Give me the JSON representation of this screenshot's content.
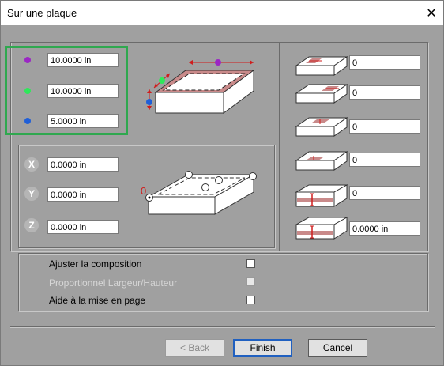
{
  "window": {
    "title": "Sur une plaque",
    "close_symbol": "✕"
  },
  "dimensions": {
    "width_value": "10.0000 in",
    "depth_value": "10.0000 in",
    "height_value": "5.0000 in",
    "colors": {
      "width": "#9b27c4",
      "depth": "#2ee85a",
      "height": "#1f5fd8"
    }
  },
  "position": {
    "x_label": "X",
    "x_value": "0.0000 in",
    "y_label": "Y",
    "y_value": "0.0000 in",
    "z_label": "Z",
    "z_value": "0.0000 in",
    "origin_label": "0"
  },
  "margins": {
    "values": [
      "0",
      "0",
      "0",
      "0",
      "0",
      "0.0000 in"
    ]
  },
  "options": {
    "adjust_label": "Ajuster la composition",
    "adjust_checked": false,
    "proportional_label": "Proportionnel Largeur/Hauteur",
    "proportional_checked": false,
    "proportional_enabled": false,
    "layout_label": "Aide à la mise en page",
    "layout_checked": false
  },
  "buttons": {
    "back": "< Back",
    "finish": "Finish",
    "cancel": "Cancel"
  }
}
